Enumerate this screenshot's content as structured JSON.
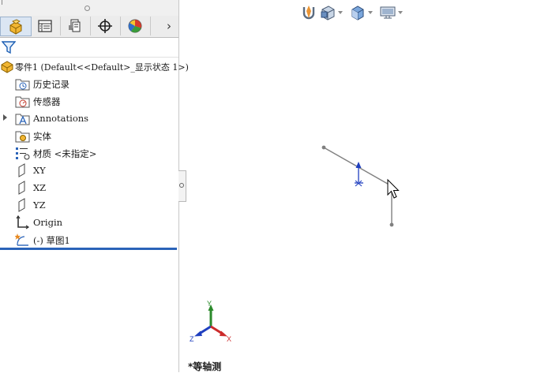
{
  "feature_tree": {
    "root": {
      "label": "零件1  (Default<<Default>_显示状态 1>)"
    },
    "items": [
      {
        "label": "历史记录",
        "icon": "history-folder-icon"
      },
      {
        "label": "传感器",
        "icon": "sensors-folder-icon"
      },
      {
        "label": "Annotations",
        "icon": "annotations-folder-icon",
        "expandable": true
      },
      {
        "label": "实体",
        "icon": "solid-bodies-folder-icon"
      },
      {
        "label": "材质 <未指定>",
        "icon": "material-icon"
      },
      {
        "label": "XY",
        "icon": "plane-icon"
      },
      {
        "label": "XZ",
        "icon": "plane-icon"
      },
      {
        "label": "YZ",
        "icon": "plane-icon"
      },
      {
        "label": "Origin",
        "icon": "origin-icon"
      },
      {
        "label": "(-) 草图1",
        "icon": "sketch-icon"
      }
    ]
  },
  "tabs": [
    {
      "name": "feature-manager",
      "icon": "feature-manager-icon",
      "active": true
    },
    {
      "name": "property-manager",
      "icon": "property-manager-icon"
    },
    {
      "name": "configuration-manager",
      "icon": "configuration-manager-icon"
    },
    {
      "name": "dimxpert-manager",
      "icon": "crosshair-icon"
    },
    {
      "name": "display-manager",
      "icon": "display-manager-icon"
    }
  ],
  "toolbar": {
    "more_tabs_glyph": "›",
    "hud_icons": [
      "section-view-icon",
      "view-orientation-icon",
      "display-style-icon",
      "hide-show-items-icon"
    ]
  },
  "view": {
    "orientation_label": "*等轴测",
    "axis_x": "X",
    "axis_y": "Y",
    "axis_z": "Z"
  },
  "colors": {
    "rollback_bar": "#2a63b8",
    "sketch_line": "#808080",
    "origin_marker": "#1f3fbf",
    "axis_x": "#cc2b2b",
    "axis_y": "#2b8a2b",
    "axis_z": "#1f3fbf"
  }
}
